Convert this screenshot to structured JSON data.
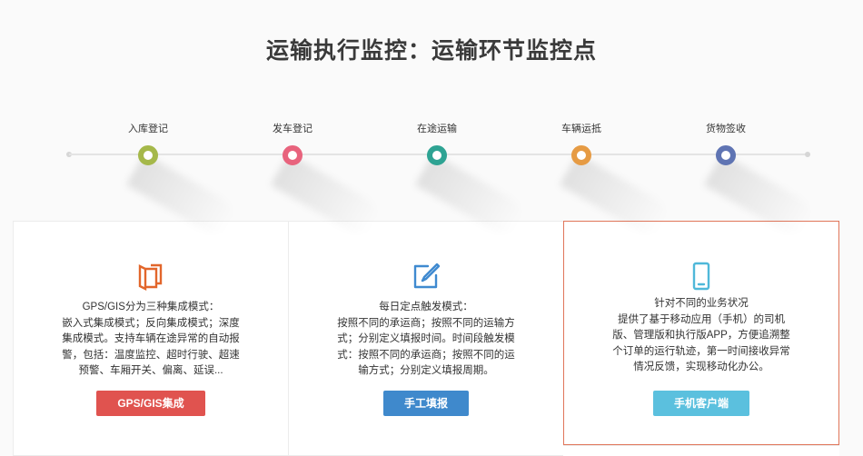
{
  "page": {
    "title": "运输执行监控：运输环节监控点"
  },
  "timeline": {
    "steps": [
      {
        "label": "入库登记",
        "color": "#a5b84a"
      },
      {
        "label": "发车登记",
        "color": "#e8637d"
      },
      {
        "label": "在途运输",
        "color": "#2ea393"
      },
      {
        "label": "车辆运抵",
        "color": "#e69b44"
      },
      {
        "label": "货物签收",
        "color": "#5f74b3"
      }
    ]
  },
  "cards": [
    {
      "icon": "book-icon",
      "icon_color": "#e2662b",
      "lines": [
        "GPS/GIS分为三种集成模式：",
        "嵌入式集成模式；反向集成模式；深度",
        "集成模式。支持车辆在途异常的自动报",
        "警，包括：温度监控、超时行驶、超速",
        "预警、车厢开关、偏离、延误..."
      ],
      "button_label": "GPS/GIS集成",
      "button_color": "#e0534f"
    },
    {
      "icon": "edit-icon",
      "icon_color": "#3f8ad0",
      "lines": [
        "每日定点触发模式：",
        "按照不同的承运商；按照不同的运输方",
        "式；分别定义填报时间。时间段触发模",
        "式：按照不同的承运商；按照不同的运",
        "输方式；分别定义填报周期。"
      ],
      "button_label": "手工填报",
      "button_color": "#3f89cc"
    },
    {
      "icon": "mobile-icon",
      "icon_color": "#4fb8d9",
      "lines": [
        "针对不同的业务状况",
        "提供了基于移动应用（手机）的司机",
        "版、管理版和执行版APP，方便追溯整",
        "个订单的运行轨迹，第一时间接收异常",
        "情况反馈，实现移动化办公。"
      ],
      "button_label": "手机客户端",
      "button_color": "#5bc0de"
    }
  ]
}
